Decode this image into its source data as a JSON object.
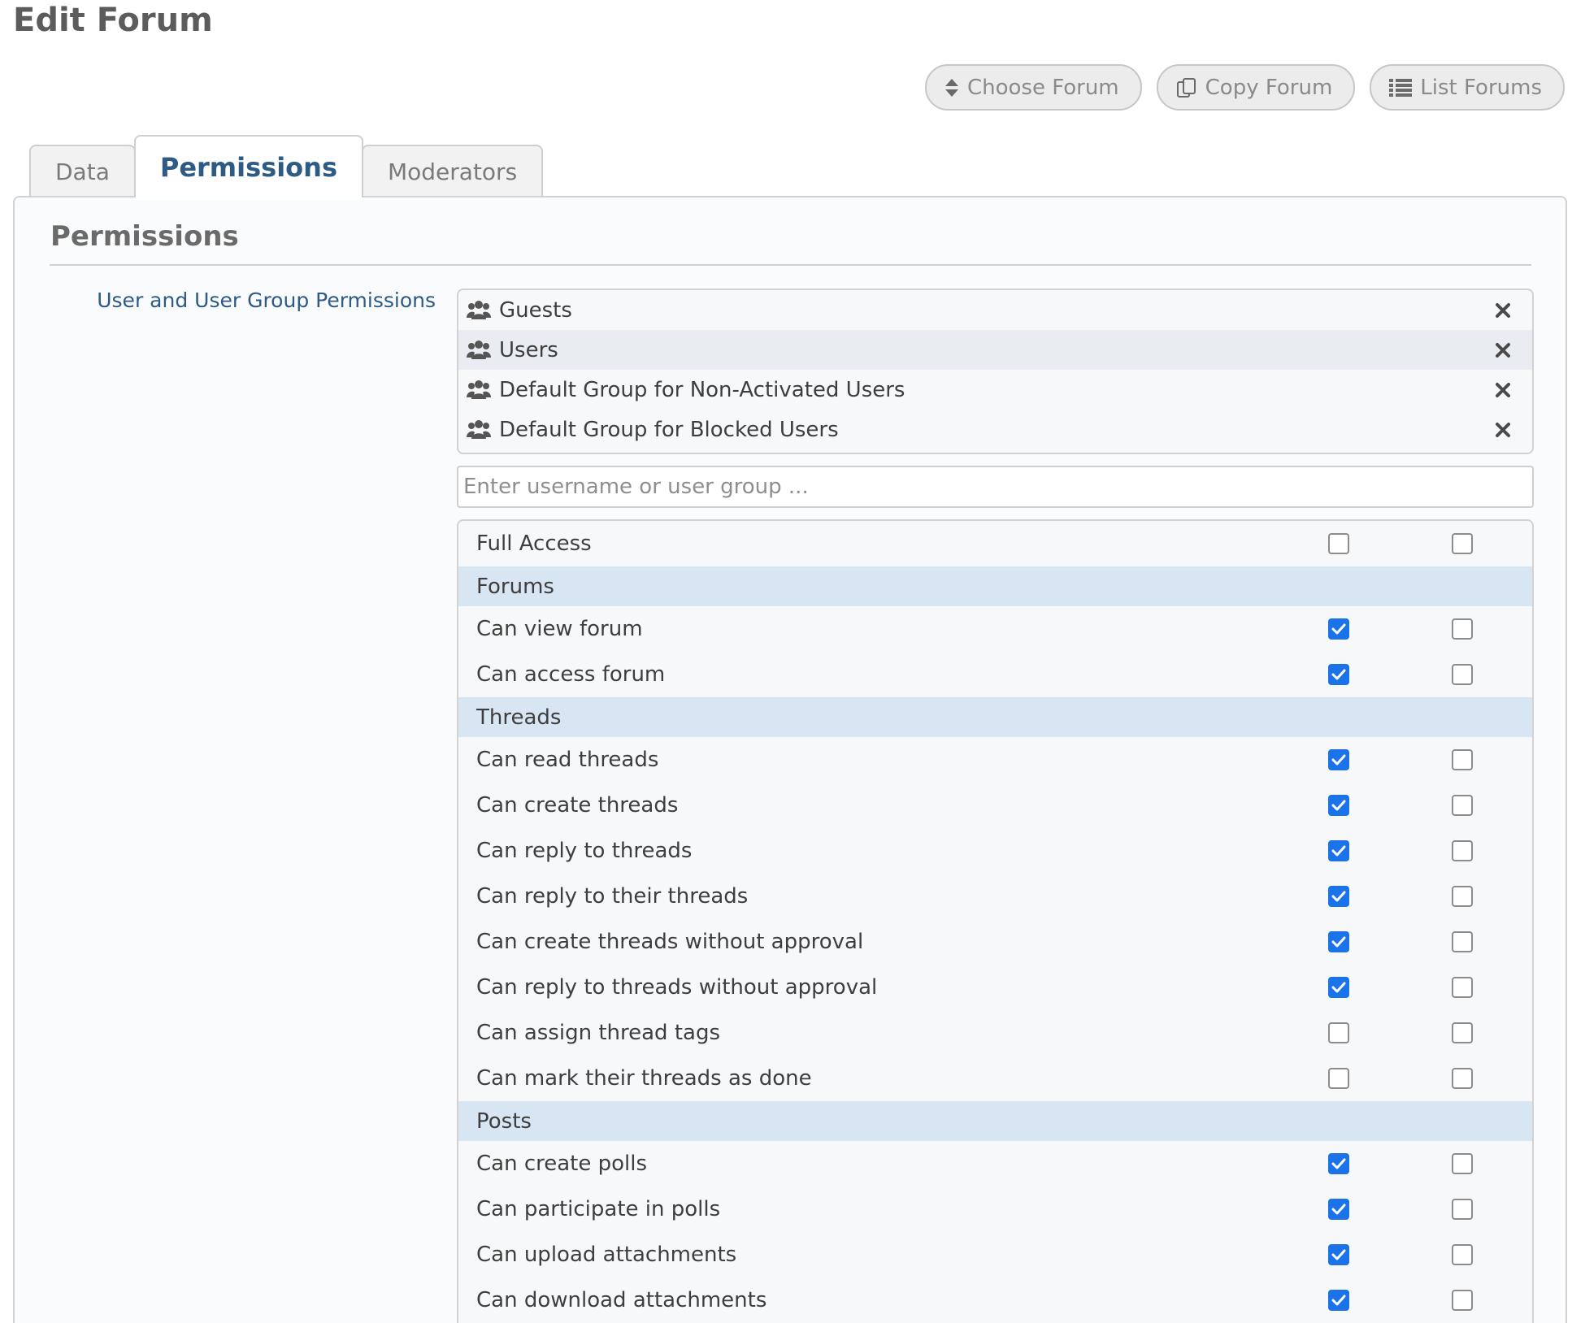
{
  "page": {
    "title": "Edit Forum"
  },
  "toolbar": {
    "choose_forum": "Choose Forum",
    "copy_forum": "Copy Forum",
    "list_forums": "List Forums"
  },
  "tabs": [
    {
      "label": "Data",
      "active": false
    },
    {
      "label": "Permissions",
      "active": true
    },
    {
      "label": "Moderators",
      "active": false
    }
  ],
  "section": {
    "title": "Permissions",
    "field_label": "User and User Group Permissions"
  },
  "groups": [
    {
      "name": "Guests",
      "highlighted": false
    },
    {
      "name": "Users",
      "highlighted": true
    },
    {
      "name": "Default Group for Non-Activated Users",
      "highlighted": false
    },
    {
      "name": "Default Group for Blocked Users",
      "highlighted": false
    }
  ],
  "search": {
    "placeholder": "Enter username or user group ...",
    "value": ""
  },
  "permissions": {
    "full_access": {
      "label": "Full Access",
      "grant": false,
      "deny": false
    },
    "categories": [
      {
        "name": "Forums",
        "items": [
          {
            "label": "Can view forum",
            "grant": true,
            "deny": false
          },
          {
            "label": "Can access forum",
            "grant": true,
            "deny": false
          }
        ]
      },
      {
        "name": "Threads",
        "items": [
          {
            "label": "Can read threads",
            "grant": true,
            "deny": false
          },
          {
            "label": "Can create threads",
            "grant": true,
            "deny": false
          },
          {
            "label": "Can reply to threads",
            "grant": true,
            "deny": false
          },
          {
            "label": "Can reply to their threads",
            "grant": true,
            "deny": false
          },
          {
            "label": "Can create threads without approval",
            "grant": true,
            "deny": false
          },
          {
            "label": "Can reply to threads without approval",
            "grant": true,
            "deny": false
          },
          {
            "label": "Can assign thread tags",
            "grant": false,
            "deny": false
          },
          {
            "label": "Can mark their threads as done",
            "grant": false,
            "deny": false
          }
        ]
      },
      {
        "name": "Posts",
        "items": [
          {
            "label": "Can create polls",
            "grant": true,
            "deny": false
          },
          {
            "label": "Can participate in polls",
            "grant": true,
            "deny": false
          },
          {
            "label": "Can upload attachments",
            "grant": true,
            "deny": false
          },
          {
            "label": "Can download attachments",
            "grant": true,
            "deny": false
          }
        ]
      }
    ]
  },
  "icons": {
    "choose": "sort-updown-icon",
    "copy": "copy-icon",
    "list": "list-icon",
    "group": "users-group-icon",
    "remove": "close-icon"
  },
  "colors": {
    "accent": "#2d5b86",
    "checkbox_on": "#1a73e8",
    "category_bg": "#d8e5f3"
  }
}
